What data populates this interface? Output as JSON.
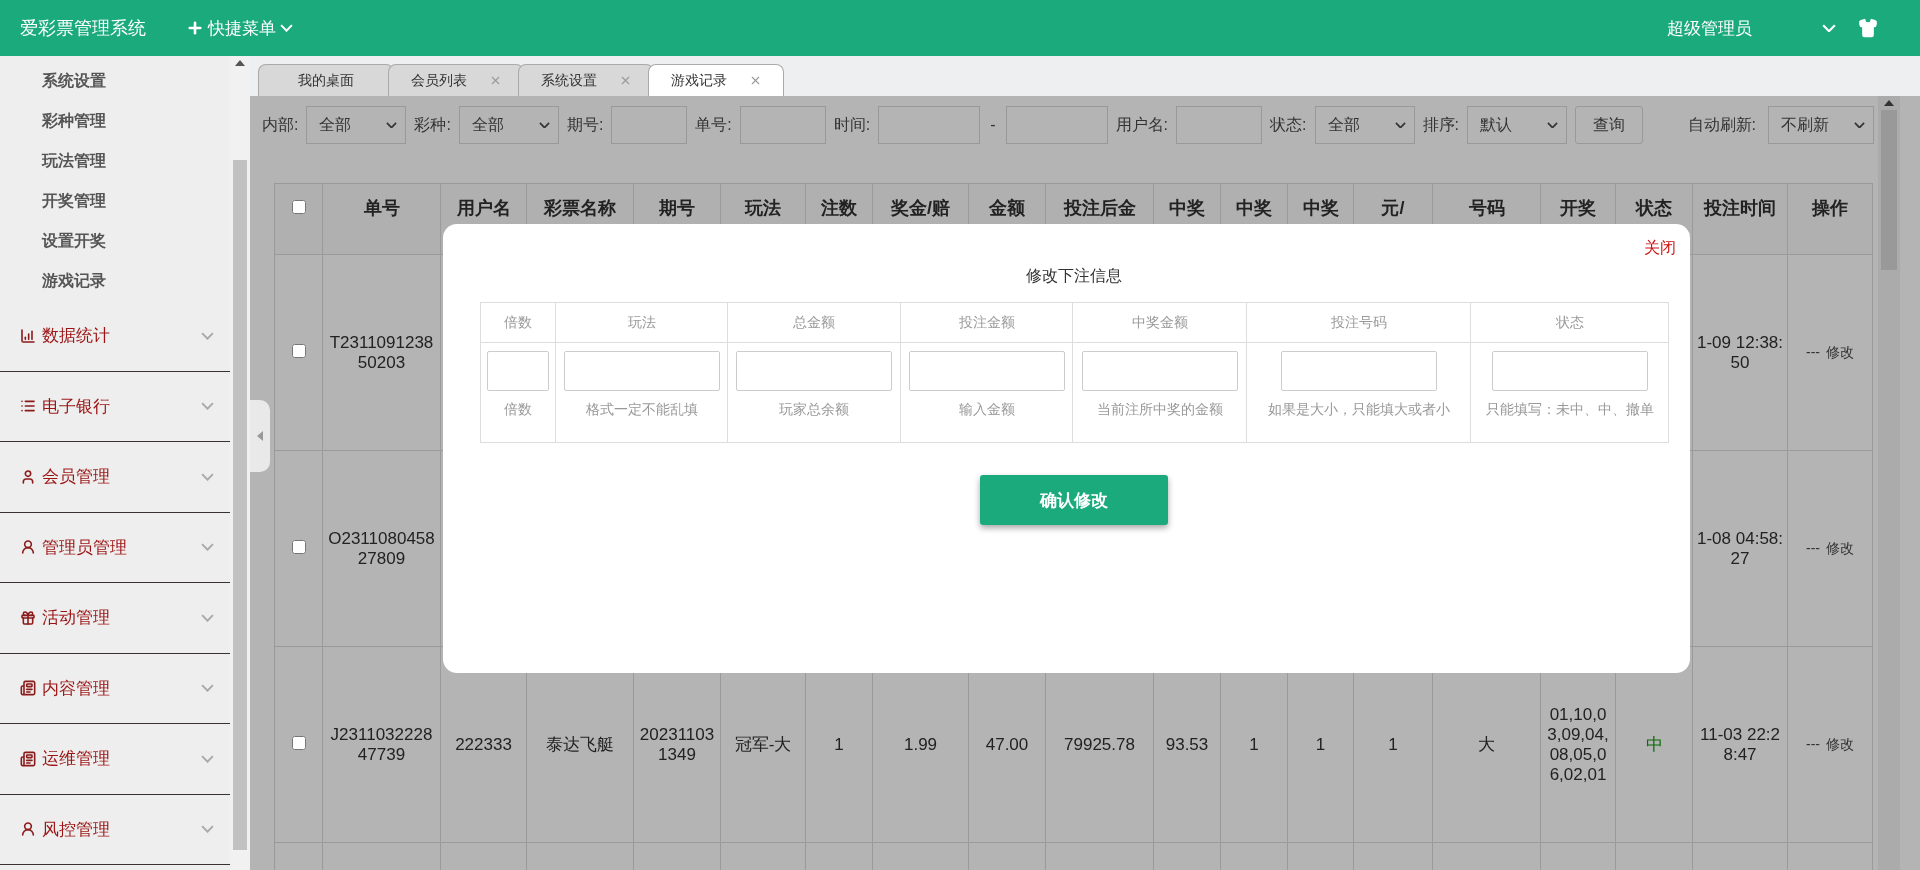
{
  "header": {
    "title": "爱彩票管理系统",
    "quick_menu": "快捷菜单",
    "user": "超级管理员"
  },
  "sidebar": {
    "sub_items": [
      {
        "label": "系统设置"
      },
      {
        "label": "彩种管理"
      },
      {
        "label": "玩法管理"
      },
      {
        "label": "开奖管理"
      },
      {
        "label": "设置开奖"
      },
      {
        "label": "游戏记录"
      }
    ],
    "groups": [
      {
        "label": "数据统计",
        "expanded": false
      },
      {
        "label": "电子银行",
        "expanded": false
      },
      {
        "label": "会员管理",
        "expanded": false
      },
      {
        "label": "管理员管理",
        "expanded": false
      },
      {
        "label": "活动管理",
        "expanded": false
      },
      {
        "label": "内容管理",
        "expanded": false
      },
      {
        "label": "运维管理",
        "expanded": false
      },
      {
        "label": "风控管理",
        "expanded": false
      }
    ]
  },
  "tabs": [
    {
      "label": "我的桌面",
      "closable": false,
      "selected": false
    },
    {
      "label": "会员列表",
      "closable": true,
      "selected": false
    },
    {
      "label": "系统设置",
      "closable": true,
      "selected": false
    },
    {
      "label": "游戏记录",
      "closable": true,
      "selected": true
    }
  ],
  "filters": [
    {
      "kind": "select",
      "label": "内部:",
      "value": "全部"
    },
    {
      "kind": "select",
      "label": "彩种:",
      "value": "全部"
    },
    {
      "kind": "input",
      "label": "期号:"
    },
    {
      "kind": "input",
      "label": "单号:"
    },
    {
      "kind": "range",
      "label": "时间:",
      "separator": "-"
    },
    {
      "kind": "input",
      "label": "用户名:"
    },
    {
      "kind": "select",
      "label": "状态:",
      "value": "全部"
    },
    {
      "kind": "select",
      "label": "排序:",
      "value": "默认"
    },
    {
      "kind": "button",
      "label": "查询"
    }
  ],
  "auto_refresh": {
    "label": "自动刷新:",
    "value": "不刷新"
  },
  "table": {
    "header_checked": false,
    "columns": [
      "单号",
      "用户名",
      "彩票名称",
      "期号",
      "玩法",
      "注数",
      "奖金/赔",
      "金额",
      "投注后金",
      "中奖",
      "中奖",
      "中奖",
      "元/",
      "号码",
      "开奖",
      "状态",
      "投注时间",
      "操作"
    ],
    "rows": [
      {
        "checked": false,
        "order_no": "T231109123850203",
        "bet_time": "1-09 12:38:50",
        "action_prefix": "---",
        "action": "修改"
      },
      {
        "checked": false,
        "order_no": "O231108045827809",
        "bet_time": "1-08 04:58:27",
        "action_prefix": "---",
        "action": "修改"
      },
      {
        "checked": false,
        "order_no": "J231103222847739",
        "details": [
          "222333",
          "泰达飞艇",
          "202311031349",
          "冠军-大",
          "1",
          "1.99",
          "47.00",
          "79925.78",
          "93.53",
          "1",
          "1",
          "1",
          "大",
          "01,10,03,09,04,08,05,06,02,01",
          "中"
        ],
        "bet_time": "11-03 22:28:47",
        "action_prefix": "---",
        "action": "修改"
      }
    ]
  },
  "modal": {
    "title": "修改下注信息",
    "close": "关闭",
    "fields": [
      {
        "label": "倍数",
        "hint": "倍数"
      },
      {
        "label": "玩法",
        "hint": "格式一定不能乱填"
      },
      {
        "label": "总金额",
        "hint": "玩家总余额"
      },
      {
        "label": "投注金额",
        "hint": "输入金额"
      },
      {
        "label": "中奖金额",
        "hint": "当前注所中奖的金额"
      },
      {
        "label": "投注号码",
        "hint": "如果是大小，只能填大或者小"
      },
      {
        "label": "状态",
        "hint": "只能填写：未中、中、撤单"
      }
    ],
    "confirm": "确认修改"
  }
}
